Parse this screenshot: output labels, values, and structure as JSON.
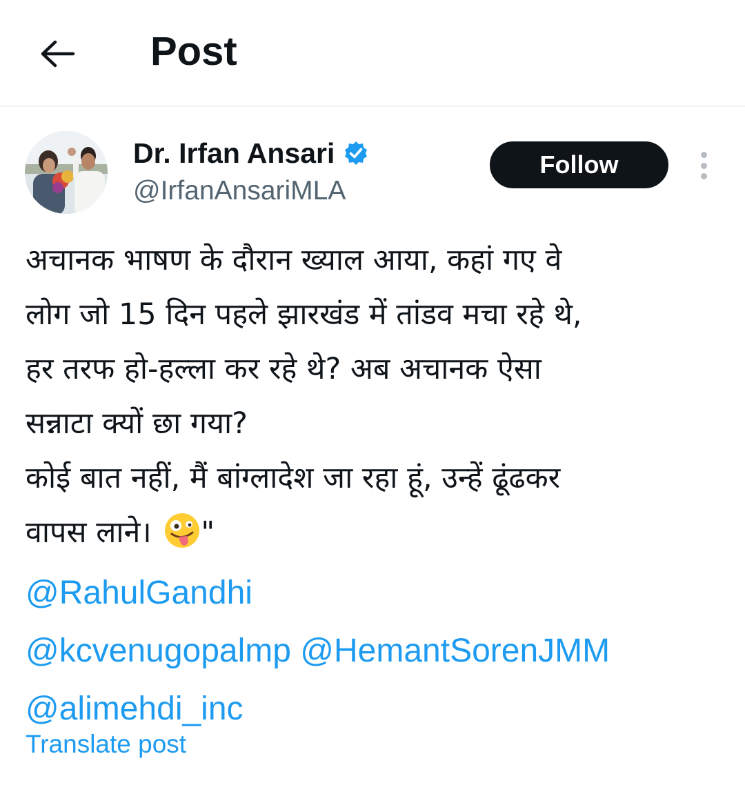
{
  "header": {
    "title": "Post",
    "back_icon": "arrow-left-icon"
  },
  "author": {
    "name": "Dr. Irfan Ansari",
    "handle": "@IrfanAnsariMLA",
    "verified_icon": "verified-badge-icon",
    "verified_color": "#1d9bf0"
  },
  "actions": {
    "follow_label": "Follow",
    "more_icon": "more-vertical-icon"
  },
  "post": {
    "lines": [
      "अचानक भाषण के दौरान ख्याल आया, कहां गए वे",
      "लोग जो 15 दिन पहले झारखंड में तांडव मचा रहे थे,",
      "हर तरफ हो-हल्ला कर रहे थे? अब अचानक ऐसा",
      "सन्नाटा क्यों छा गया?",
      "कोई बात नहीं, मैं बांग्लादेश जा रहा हूं, उन्हें ढूंढकर",
      "वापस लाने।"
    ],
    "closing_quote": "\"",
    "emoji_icon": "zany-face-emoji-icon",
    "mentions": [
      "@RahulGandhi",
      "@kcvenugopalmp",
      "@HemantSorenJMM",
      "@alimehdi_inc"
    ],
    "translate_label": "Translate post"
  },
  "colors": {
    "link": "#1d9bf0",
    "text": "#0f1419",
    "secondary": "#536471",
    "button_bg": "#0f1419"
  }
}
